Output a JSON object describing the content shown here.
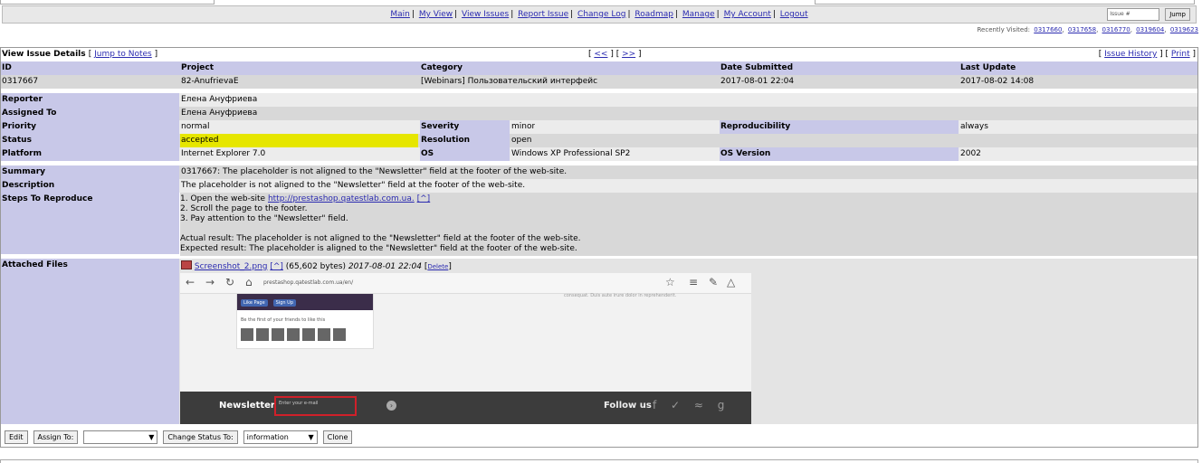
{
  "nav": {
    "links": [
      "Main",
      "My View",
      "View Issues",
      "Report Issue",
      "Change Log",
      "Roadmap",
      "Manage",
      "My Account",
      "Logout"
    ],
    "jump_placeholder": "Issue #",
    "jump_button": "Jump"
  },
  "recent": {
    "label": "Recently Visited:",
    "items": [
      "0317660",
      "0317658",
      "0316770",
      "0319604",
      "0319623"
    ]
  },
  "header": {
    "title": "View Issue Details",
    "jump_notes": "Jump to Notes",
    "prev": "<<",
    "next": ">>",
    "history": "Issue History",
    "print": "Print"
  },
  "columns": [
    "ID",
    "Project",
    "Category",
    "Date Submitted",
    "Last Update"
  ],
  "summary_row": [
    "0317667",
    "82-AnufrievaE",
    "[Webinars] Пользовательский интерфейс",
    "2017-08-01 22:04",
    "2017-08-02 14:08"
  ],
  "fields": {
    "reporter_label": "Reporter",
    "reporter": "Елена Ануфриева",
    "assigned_label": "Assigned To",
    "assigned": "Елена Ануфриева",
    "priority_label": "Priority",
    "priority": "normal",
    "severity_label": "Severity",
    "severity": "minor",
    "reproducibility_label": "Reproducibility",
    "reproducibility": "always",
    "status_label": "Status",
    "status": "accepted",
    "resolution_label": "Resolution",
    "resolution": "open",
    "platform_label": "Platform",
    "platform": "Internet Explorer 7.0",
    "os_label": "OS",
    "os": "Windows XP Professional SP2",
    "osversion_label": "OS Version",
    "osversion": "2002",
    "summary_label": "Summary",
    "summary": "0317667: The placeholder is not aligned to the \"Newsletter\" field at the footer of the web-site.",
    "description_label": "Description",
    "description": "The placeholder is not aligned to the \"Newsletter\" field at the footer of the web-site.",
    "steps_label": "Steps To Reproduce",
    "steps_1a": "1. Open the web-site ",
    "steps_link": "http://prestashop.qatestlab.com.ua.",
    "steps_link_suffix": "[^]",
    "steps_2": "2. Scroll the page to the footer.",
    "steps_3": "3. Pay attention to the \"Newsletter\" field.",
    "actual": "Actual result: The placeholder is not aligned to the \"Newsletter\" field at the footer of the web-site.",
    "expected": "Expected result: The placeholder is aligned to the \"Newsletter\" field at the footer of the web-site.",
    "attached_label": "Attached Files"
  },
  "attachment": {
    "name": "Screenshot_2.png",
    "caret": "[^]",
    "size": "(65,602 bytes)",
    "date": "2017-08-01 22:04",
    "delete": "Delete",
    "browser_url": "prestashop.qatestlab.com.ua/en/",
    "fb_like": "Like Page",
    "fb_signup": "Sign Up",
    "fb_text": "Be the first of your friends to like this",
    "consequat": "consequat. Duis aute irure dolor in reprehenderit.",
    "newsletter": "Newsletter",
    "newsletter_placeholder": "Enter your e-mail",
    "follow": "Follow us"
  },
  "actions": {
    "edit": "Edit",
    "assign": "Assign To:",
    "assign_value": "",
    "change_status": "Change Status To:",
    "status_value": "information",
    "clone": "Clone"
  }
}
